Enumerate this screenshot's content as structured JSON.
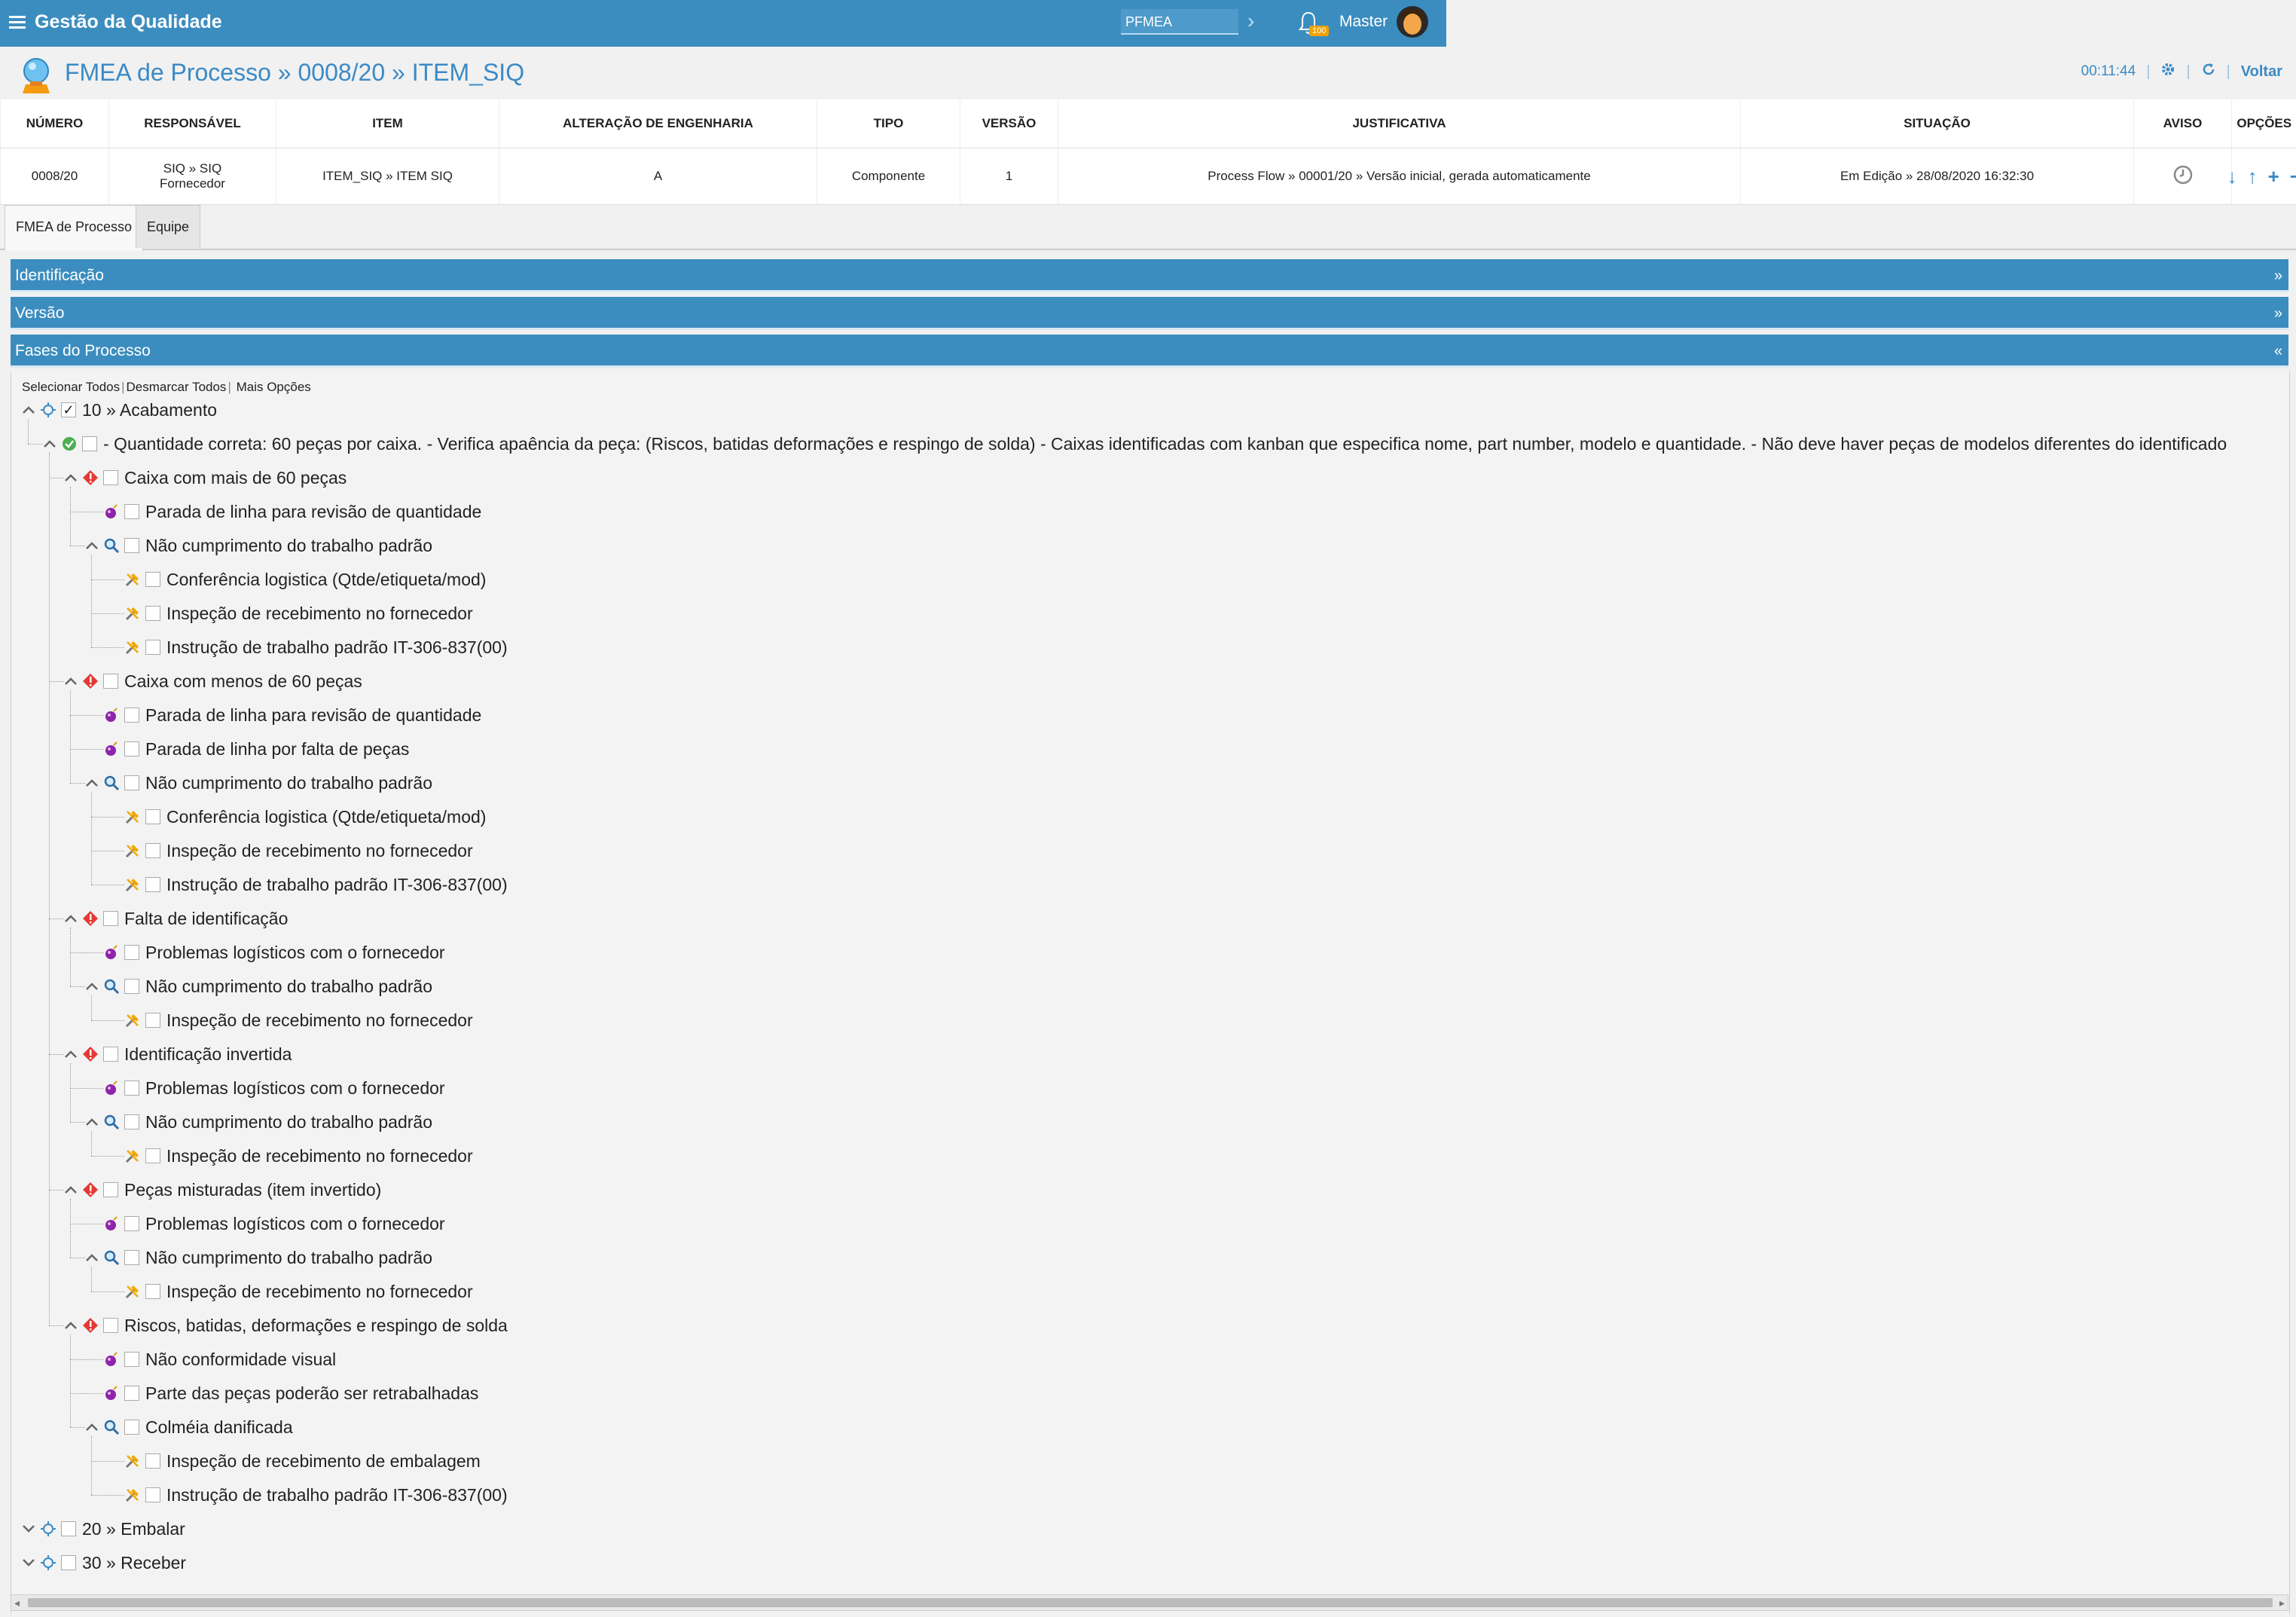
{
  "topbar": {
    "app_name": "Gestão da Qualidade",
    "module_value": "PFMEA",
    "notifications": "100",
    "user": "Master"
  },
  "page": {
    "title": "FMEA de Processo » 0008/20 » ITEM_SIQ",
    "timer": "00:11:44",
    "back_label": "Voltar"
  },
  "info_table": {
    "headers": [
      "NÚMERO",
      "RESPONSÁVEL",
      "ITEM",
      "ALTERAÇÃO DE ENGENHARIA",
      "TIPO",
      "VERSÃO",
      "JUSTIFICATIVA",
      "SITUAÇÃO",
      "AVISO",
      "OPÇÕES"
    ],
    "row": {
      "numero": "0008/20",
      "responsavel_1": "SIQ » SIQ",
      "responsavel_2": "Fornecedor",
      "item": "ITEM_SIQ » ITEM SIQ",
      "alteracao": "A",
      "tipo": "Componente",
      "versao": "1",
      "justificativa": "Process Flow » 00001/20 » Versão inicial, gerada automaticamente",
      "situacao": "Em Edição » 28/08/2020 16:32:30"
    }
  },
  "tabs": [
    "FMEA de Processo",
    "Equipe"
  ],
  "panels": {
    "identificacao": "Identificação",
    "versao": "Versão",
    "fases": "Fases do Processo",
    "collapsed_glyph": "»",
    "expanded_glyph": "«"
  },
  "quick_actions": {
    "select_all": "Selecionar Todos",
    "deselect_all": "Desmarcar Todos",
    "more": "Mais Opções"
  },
  "tree": [
    {
      "level": 0,
      "type": "phase",
      "label": "10 » Acabamento",
      "expanded": true,
      "checked": true
    },
    {
      "level": 1,
      "type": "requirement",
      "label": "- Quantidade correta: 60 peças por caixa. - Verifica apaência da peça: (Riscos, batidas deformações e respingo de solda) - Caixas identificadas com kanban que especifica nome, part number, modelo e quantidade. - Não deve haver peças de modelos diferentes do identificado",
      "expanded": true
    },
    {
      "level": 2,
      "type": "failure",
      "label": "Caixa com mais de 60 peças",
      "expanded": true
    },
    {
      "level": 3,
      "type": "effect",
      "label": "Parada de linha para revisão de quantidade"
    },
    {
      "level": 3,
      "type": "cause",
      "label": "Não cumprimento do trabalho padrão",
      "expanded": true
    },
    {
      "level": 4,
      "type": "control",
      "label": "Conferência logistica (Qtde/etiqueta/mod)"
    },
    {
      "level": 4,
      "type": "control",
      "label": "Inspeção de recebimento no fornecedor"
    },
    {
      "level": 4,
      "type": "control",
      "label": "Instrução de trabalho padrão IT-306-837(00)"
    },
    {
      "level": 2,
      "type": "failure",
      "label": "Caixa com menos de 60 peças",
      "expanded": true
    },
    {
      "level": 3,
      "type": "effect",
      "label": "Parada de linha para revisão de quantidade"
    },
    {
      "level": 3,
      "type": "effect",
      "label": "Parada de linha por falta de peças"
    },
    {
      "level": 3,
      "type": "cause",
      "label": "Não cumprimento do trabalho padrão",
      "expanded": true
    },
    {
      "level": 4,
      "type": "control",
      "label": "Conferência logistica (Qtde/etiqueta/mod)"
    },
    {
      "level": 4,
      "type": "control",
      "label": "Inspeção de recebimento no fornecedor"
    },
    {
      "level": 4,
      "type": "control",
      "label": "Instrução de trabalho padrão IT-306-837(00)"
    },
    {
      "level": 2,
      "type": "failure",
      "label": "Falta de identificação",
      "expanded": true
    },
    {
      "level": 3,
      "type": "effect",
      "label": "Problemas logísticos com o fornecedor"
    },
    {
      "level": 3,
      "type": "cause",
      "label": "Não cumprimento do trabalho padrão",
      "expanded": true
    },
    {
      "level": 4,
      "type": "control",
      "label": "Inspeção de recebimento no fornecedor"
    },
    {
      "level": 2,
      "type": "failure",
      "label": "Identificação invertida",
      "expanded": true
    },
    {
      "level": 3,
      "type": "effect",
      "label": "Problemas logísticos com o fornecedor"
    },
    {
      "level": 3,
      "type": "cause",
      "label": "Não cumprimento do trabalho padrão",
      "expanded": true
    },
    {
      "level": 4,
      "type": "control",
      "label": "Inspeção de recebimento no fornecedor"
    },
    {
      "level": 2,
      "type": "failure",
      "label": "Peças misturadas (item invertido)",
      "expanded": true
    },
    {
      "level": 3,
      "type": "effect",
      "label": "Problemas logísticos com o fornecedor"
    },
    {
      "level": 3,
      "type": "cause",
      "label": "Não cumprimento do trabalho padrão",
      "expanded": true
    },
    {
      "level": 4,
      "type": "control",
      "label": "Inspeção de recebimento no fornecedor"
    },
    {
      "level": 2,
      "type": "failure",
      "label": "Riscos, batidas, deformações e respingo de solda",
      "expanded": true
    },
    {
      "level": 3,
      "type": "effect",
      "label": "Não conformidade visual"
    },
    {
      "level": 3,
      "type": "effect",
      "label": "Parte das peças poderão ser retrabalhadas"
    },
    {
      "level": 3,
      "type": "cause",
      "label": "Colméia danificada",
      "expanded": true
    },
    {
      "level": 4,
      "type": "control",
      "label": "Inspeção de recebimento de embalagem"
    },
    {
      "level": 4,
      "type": "control",
      "label": "Instrução de trabalho padrão IT-306-837(00)"
    },
    {
      "level": 0,
      "type": "phase",
      "label": "20 » Embalar",
      "expanded": false
    },
    {
      "level": 0,
      "type": "phase",
      "label": "30 » Receber",
      "expanded": false
    }
  ],
  "colors": {
    "brand": "#3c8dbf",
    "link": "#3a8ac6",
    "failure": "#e53935",
    "effect": "#8e24aa",
    "requirement": "#4caf50",
    "control": "#f2a900"
  }
}
